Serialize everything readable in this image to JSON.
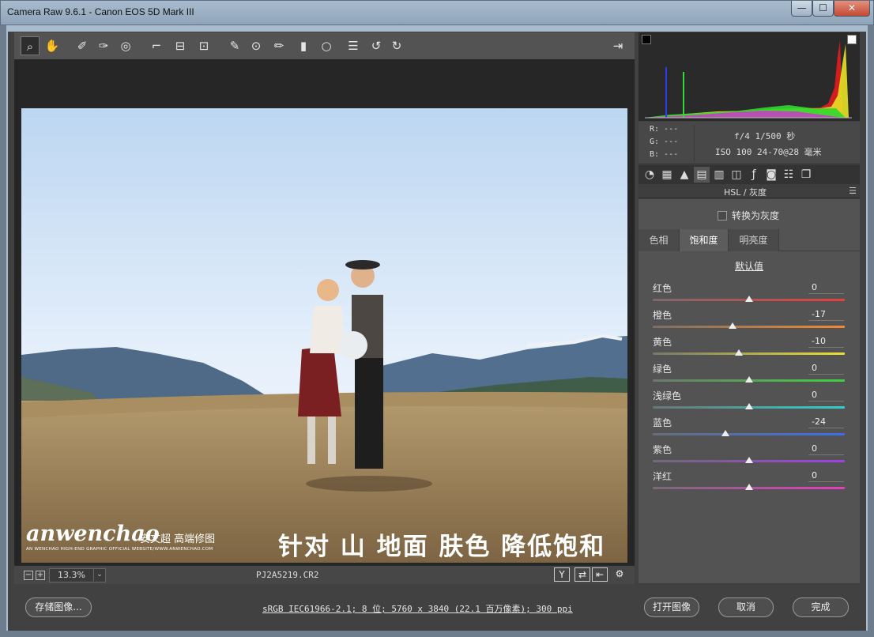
{
  "window": {
    "title": "Camera Raw 9.6.1 -  Canon EOS 5D Mark III",
    "minimize": "—",
    "maximize": "☐",
    "close": "✕"
  },
  "toolbar": {
    "tools": [
      {
        "icon": "zoom-icon",
        "glyph": "⌕"
      },
      {
        "icon": "hand-icon",
        "glyph": "✋"
      },
      {
        "icon": "white-balance-icon",
        "glyph": "✐"
      },
      {
        "icon": "color-sampler-icon",
        "glyph": "✑"
      },
      {
        "icon": "targeted-adjustment-icon",
        "glyph": "◎"
      },
      {
        "icon": "crop-icon",
        "glyph": "⌐"
      },
      {
        "icon": "straighten-icon",
        "glyph": "⊟"
      },
      {
        "icon": "transform-icon",
        "glyph": "⊡"
      },
      {
        "icon": "spot-removal-icon",
        "glyph": "✎"
      },
      {
        "icon": "red-eye-icon",
        "glyph": "⊙"
      },
      {
        "icon": "adjustment-brush-icon",
        "glyph": "✏"
      },
      {
        "icon": "graduated-filter-icon",
        "glyph": "▮"
      },
      {
        "icon": "radial-filter-icon",
        "glyph": "○"
      },
      {
        "icon": "preferences-icon",
        "glyph": "☰"
      },
      {
        "icon": "rotate-ccw-icon",
        "glyph": "↺"
      },
      {
        "icon": "rotate-cw-icon",
        "glyph": "↻"
      }
    ],
    "fullscreen_glyph": "⇥"
  },
  "preview": {
    "caption": "针对 山 地面 肤色 降低饱和",
    "logo_brand": "anwenchao",
    "logo_cn": "安文超 高端修图",
    "logo_tagline": "AN WENCHAO HIGH-END GRAPHIC OFFICIAL WEBSITE/WWW.ANWENCHAO.COM"
  },
  "bottombar": {
    "zoom_minus": "−",
    "zoom_plus": "+",
    "zoom": "13.3%",
    "zoom_dropdown": "⌄",
    "filename": "PJ2A5219.CR2",
    "icons": [
      {
        "name": "before-after-icon",
        "glyph": "Y"
      },
      {
        "name": "swap-settings-icon",
        "glyph": "⇄"
      },
      {
        "name": "copy-settings-icon",
        "glyph": "⇤"
      },
      {
        "name": "preview-settings-icon",
        "glyph": "⚙"
      }
    ]
  },
  "readout": {
    "r": "R:  ---",
    "g": "G:  ---",
    "b": "B:  ---",
    "exif_line1": "f/4  1/500 秒",
    "exif_line2": "ISO 100   24-70@28 毫米"
  },
  "panel_tabs": [
    "basic-icon",
    "tone-curve-icon",
    "detail-icon",
    "hsl-icon",
    "split-toning-icon",
    "lens-icon",
    "effects-icon",
    "camera-calibration-icon",
    "presets-icon",
    "snapshots-icon"
  ],
  "panel": {
    "title": "HSL / 灰度",
    "menu": "☰",
    "grayscale_label": "转换为灰度",
    "tabs": [
      "色相",
      "饱和度",
      "明亮度"
    ],
    "active_tab": "饱和度",
    "defaults": "默认值",
    "sliders": [
      {
        "label": "红色",
        "value": "0",
        "num": 0,
        "gradient": "linear-gradient(90deg,#7a6a6a,#e84040)"
      },
      {
        "label": "橙色",
        "value": "-17",
        "num": -17,
        "gradient": "linear-gradient(90deg,#7a7068,#f08a30)"
      },
      {
        "label": "黄色",
        "value": "-10",
        "num": -10,
        "gradient": "linear-gradient(90deg,#78786a,#e8e030)"
      },
      {
        "label": "绿色",
        "value": "0",
        "num": 0,
        "gradient": "linear-gradient(90deg,#6e786e,#40d040)"
      },
      {
        "label": "浅绿色",
        "value": "0",
        "num": 0,
        "gradient": "linear-gradient(90deg,#6a7676,#30d0c8)"
      },
      {
        "label": "蓝色",
        "value": "-24",
        "num": -24,
        "gradient": "linear-gradient(90deg,#6a6e7a,#3a70e8)"
      },
      {
        "label": "紫色",
        "value": "0",
        "num": 0,
        "gradient": "linear-gradient(90deg,#726a7a,#a040e0)"
      },
      {
        "label": "洋红",
        "value": "0",
        "num": 0,
        "gradient": "linear-gradient(90deg,#786a76,#e040c0)"
      }
    ]
  },
  "footer": {
    "save": "存储图像...",
    "workflow": "sRGB IEC61966-2.1; 8 位; 5760 x 3840 (22.1 百万像素); 300 ppi",
    "open": "打开图像",
    "cancel": "取消",
    "done": "完成"
  }
}
